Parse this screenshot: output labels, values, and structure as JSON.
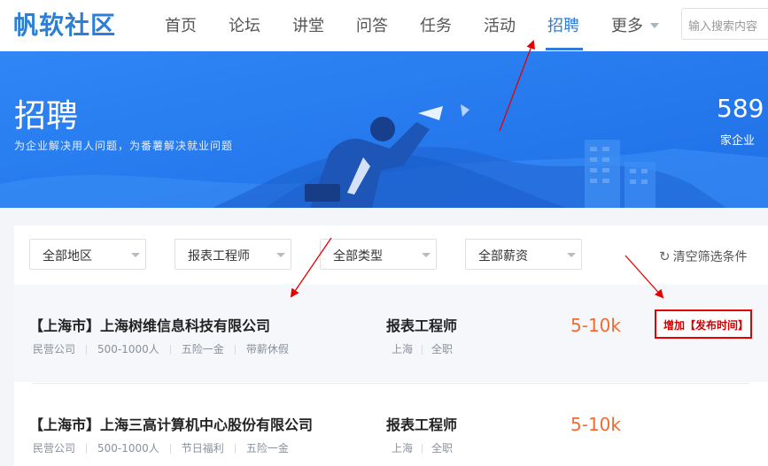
{
  "nav": {
    "logo": "帆软社区",
    "items": [
      "首页",
      "论坛",
      "讲堂",
      "问答",
      "任务",
      "活动",
      "招聘",
      "更多"
    ],
    "active_index": 6,
    "search_placeholder": "输入搜索内容"
  },
  "banner": {
    "title": "招聘",
    "subtitle": "为企业解决用人问题，为番薯解决就业问题",
    "stat_value": "589",
    "stat_label": "家企业"
  },
  "filters": {
    "region": "全部地区",
    "position": "报表工程师",
    "type": "全部类型",
    "salary": "全部薪资",
    "clear_label": "清空筛选条件"
  },
  "jobs": [
    {
      "company": "【上海市】上海树维信息科技有限公司",
      "tags": [
        "民营公司",
        "500-1000人",
        "五险一金",
        "带薪休假"
      ],
      "position": "报表工程师",
      "location": [
        "上海",
        "全职"
      ],
      "salary": "5-10k"
    },
    {
      "company": "【上海市】上海三高计算机中心股份有限公司",
      "tags": [
        "民营公司",
        "500-1000人",
        "节日福利",
        "五险一金"
      ],
      "position": "报表工程师",
      "location": [
        "上海",
        "全职"
      ],
      "salary": "5-10k"
    }
  ],
  "annotation": {
    "text": "增加【发布时间】",
    "color": "#e60000"
  },
  "colors": {
    "brand": "#2e7cd8",
    "banner": "#2b7ef0",
    "salary": "#f56a32"
  }
}
